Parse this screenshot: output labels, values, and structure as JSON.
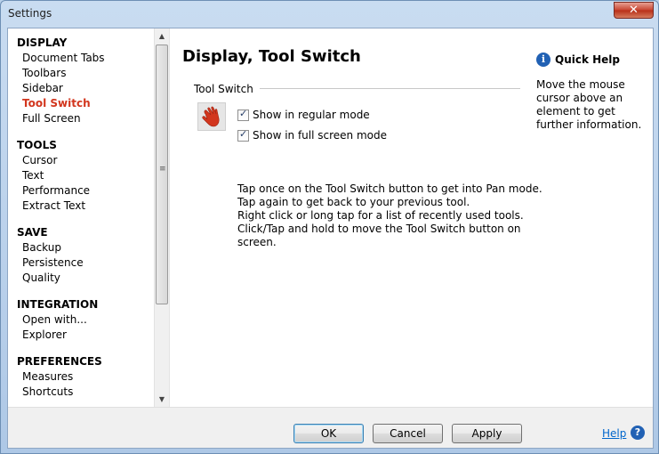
{
  "window": {
    "title": "Settings",
    "close_glyph": "✕"
  },
  "sidebar": {
    "sections": [
      {
        "heading": "DISPLAY",
        "items": [
          "Document Tabs",
          "Toolbars",
          "Sidebar",
          "Tool Switch",
          "Full Screen"
        ]
      },
      {
        "heading": "TOOLS",
        "items": [
          "Cursor",
          "Text",
          "Performance",
          "Extract Text"
        ]
      },
      {
        "heading": "SAVE",
        "items": [
          "Backup",
          "Persistence",
          "Quality"
        ]
      },
      {
        "heading": "INTEGRATION",
        "items": [
          "Open with...",
          "Explorer"
        ]
      },
      {
        "heading": "PREFERENCES",
        "items": [
          "Measures",
          "Shortcuts"
        ]
      }
    ],
    "active_item": "Tool Switch",
    "scroll_up_glyph": "▲",
    "scroll_down_glyph": "▼",
    "thumb_grip_glyph": "≡"
  },
  "main": {
    "title": "Display, Tool Switch",
    "group_label": "Tool Switch",
    "tool_icon": "hand-pan-icon",
    "accent_color": "#d2361e",
    "checkboxes": [
      {
        "label": "Show in regular mode",
        "checked": true
      },
      {
        "label": "Show in full screen mode",
        "checked": true
      }
    ],
    "check_glyph": "✓",
    "description": [
      "Tap once on the Tool Switch button to get into Pan mode.",
      "Tap again to get back to your previous tool.",
      "Right click or long tap for a list of recently used tools.",
      "Click/Tap and hold to move the Tool Switch button on",
      "screen."
    ]
  },
  "quick_help": {
    "icon_glyph": "i",
    "title": "Quick Help",
    "text": "Move the mouse cursor above an element to get further information."
  },
  "footer": {
    "ok_label": "OK",
    "cancel_label": "Cancel",
    "apply_label": "Apply",
    "help_label": "Help",
    "help_icon_glyph": "?"
  }
}
